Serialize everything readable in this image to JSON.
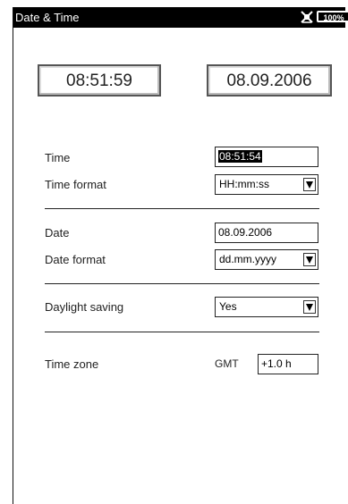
{
  "window": {
    "title": "Date & Time",
    "battery": "100%"
  },
  "clocks": {
    "time": "08:51:59",
    "date": "08.09.2006"
  },
  "time": {
    "label": "Time",
    "value": "08:51:54"
  },
  "time_format": {
    "label": "Time format",
    "value": "HH:mm:ss"
  },
  "date": {
    "label": "Date",
    "value": "08.09.2006"
  },
  "date_format": {
    "label": "Date format",
    "value": "dd.mm.yyyy"
  },
  "daylight": {
    "label": "Daylight saving",
    "value": "Yes"
  },
  "timezone": {
    "label": "Time zone",
    "prefix": "GMT",
    "value": "+1.0 h"
  }
}
